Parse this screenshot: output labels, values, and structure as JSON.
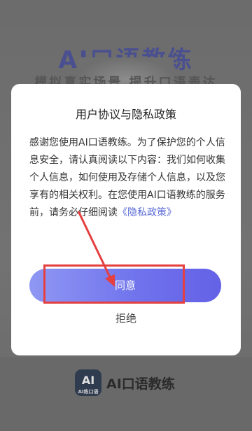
{
  "background": {
    "title": "AI口语教练",
    "subtitle": "模拟真实场景 提升口语表达",
    "brand_name": "AI口语教练",
    "logo_text": "AI",
    "logo_caption": "AI练口语"
  },
  "dialog": {
    "title": "用户协议与隐私政策",
    "body_prefix": "感谢您使用AI口语教练。为了保护您的个人信息安全，请认真阅读以下内容：我们如何收集个人信息，如何使用及存储个人信息，以及您享有的相关权利。在您使用AI口语教练的服务前，请务必仔细阅读",
    "policy_link": "《隐私政策》",
    "agree_label": "同意",
    "refuse_label": "拒绝"
  },
  "colors": {
    "accent": "#6e71ec",
    "link": "#5b6cd6",
    "annotation": "#e53f3f"
  }
}
